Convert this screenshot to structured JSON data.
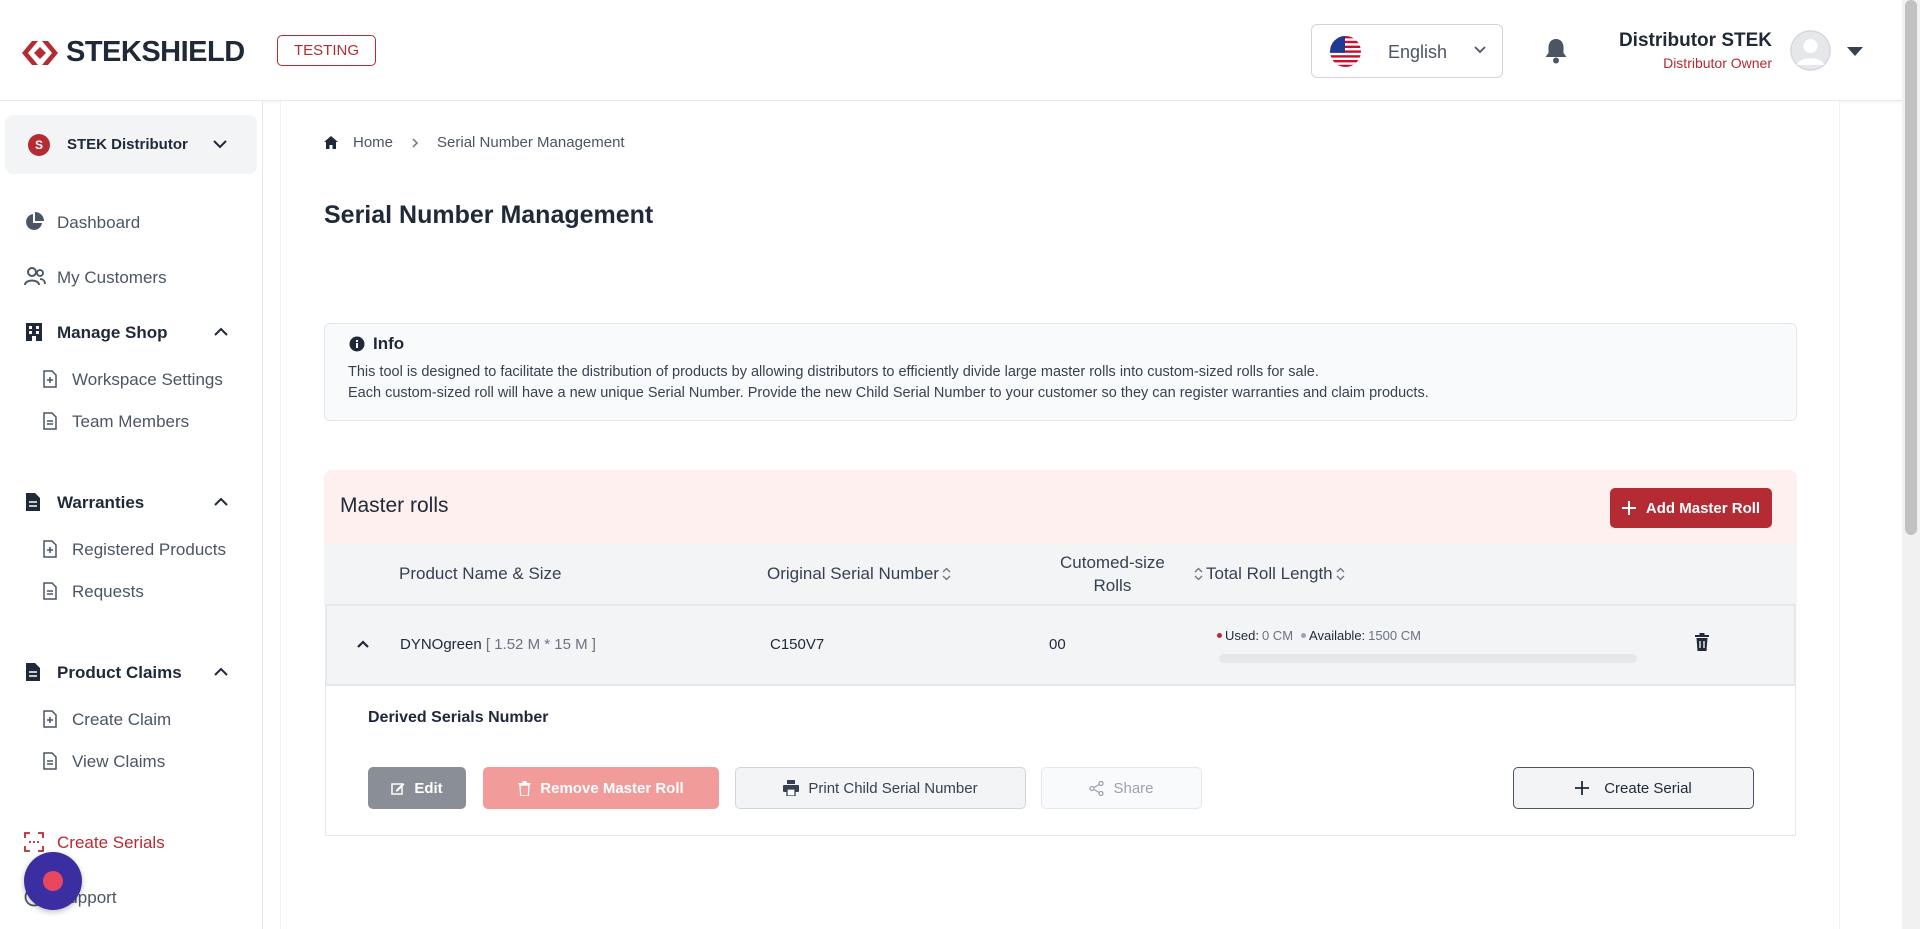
{
  "header": {
    "logo_text": "STEKSHIELD",
    "env_badge": "TESTING",
    "language": "English",
    "user_name": "Distributor STEK",
    "user_role": "Distributor Owner"
  },
  "sidebar": {
    "org_name": "STEK Distributor",
    "org_initial": "S",
    "items": [
      {
        "label": "Dashboard"
      },
      {
        "label": "My Customers"
      },
      {
        "label": "Manage Shop"
      },
      {
        "label": "Workspace Settings"
      },
      {
        "label": "Team Members"
      },
      {
        "label": "Warranties"
      },
      {
        "label": "Registered Products"
      },
      {
        "label": "Requests"
      },
      {
        "label": "Product Claims"
      },
      {
        "label": "Create Claim"
      },
      {
        "label": "View Claims"
      },
      {
        "label": "Create Serials"
      },
      {
        "label": "Support"
      }
    ]
  },
  "breadcrumb": {
    "home": "Home",
    "current": "Serial Number Management"
  },
  "page": {
    "title": "Serial Number Management"
  },
  "info": {
    "title": "Info",
    "line1": "This tool is designed to facilitate the distribution of products by allowing distributors to efficiently divide large master rolls into custom-sized rolls for sale.",
    "line2": "Each custom-sized roll will have a new unique Serial Number. Provide the new Child Serial Number to your customer so they can register warranties and claim products."
  },
  "master_rolls": {
    "title": "Master rolls",
    "add_button": "Add Master Roll",
    "columns": {
      "product": "Product Name & Size",
      "serial": "Original Serial Number",
      "custom_line1": "Cutomed-size",
      "custom_line2": "Rolls",
      "length": "Total Roll Length"
    },
    "rows": [
      {
        "product": "DYNOgreen",
        "size": "[ 1.52 M * 15 M ]",
        "serial": "C150V7",
        "custom_rolls": "00",
        "used_label": "Used:",
        "used_value": "0 CM",
        "available_label": "Available:",
        "available_value": "1500 CM",
        "used_fraction": 0
      }
    ],
    "derived": {
      "title": "Derived Serials Number",
      "edit": "Edit",
      "remove": "Remove Master Roll",
      "print": "Print Child Serial Number",
      "share": "Share",
      "create": "Create Serial"
    }
  },
  "colors": {
    "brand": "#b42b33",
    "fab": "#3b2ea0"
  }
}
